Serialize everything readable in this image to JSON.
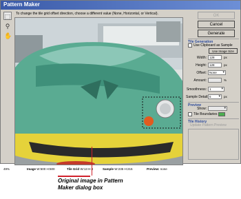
{
  "window": {
    "title": "Pattern Maker"
  },
  "instruction": "To change the tile grid offset direction, choose a different value (None, Horizontal, or Vertical).",
  "tools": [
    "marquee-tool",
    "zoom-tool",
    "hand-tool"
  ],
  "buttons": {
    "ok": "OK",
    "cancel": "Cancel",
    "generate": "Generate"
  },
  "tile_generation": {
    "title": "Tile Generation",
    "use_clipboard_label": "Use Clipboard as Sample",
    "use_image_size": "Use Image Size",
    "width_label": "Width:",
    "width_value": "128",
    "width_unit": "px",
    "height_label": "Height:",
    "height_value": "128",
    "height_unit": "px",
    "offset_label": "Offset:",
    "offset_value": "None",
    "amount_label": "Amount:",
    "amount_unit": "%",
    "smoothness_label": "Smoothness:",
    "smoothness_value": "1",
    "sample_detail_label": "Sample Detail:",
    "sample_detail_value": "5",
    "sample_detail_unit": "px"
  },
  "preview": {
    "title": "Preview",
    "show_label": "Show:",
    "tile_boundaries_label": "Tile Boundaries",
    "tile_boundaries_color": "#4caf50"
  },
  "tile_history": {
    "title": "Tile History",
    "delete_label": "Update Pattern Preview"
  },
  "status": {
    "zoom": "49%",
    "image_label": "Image",
    "image_value": "W:500 H:500",
    "tile_grid_label": "Tile Grid",
    "tile_grid_value": "W:13 H:4",
    "sample_label": "Sample",
    "sample_value": "W:235 H:215",
    "preview_label": "Preview:",
    "preview_value": "none"
  },
  "caption": {
    "line1": "Original image in Pattern",
    "line2": "Maker dialog box"
  },
  "colors": {
    "callout": "#d0202a",
    "title_bar": "#3a5aa8",
    "car_green": "#4fa88f",
    "car_yellow": "#e5d23a"
  }
}
